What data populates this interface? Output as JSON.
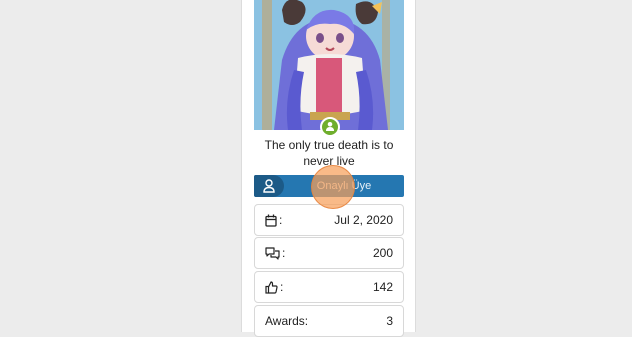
{
  "user": {
    "title": "The only true death is to never live",
    "banner": "Onaylı Üye"
  },
  "stats": {
    "joined": {
      "icon": "calendar-icon",
      "value": "Jul 2, 2020"
    },
    "messages": {
      "icon": "comments-icon",
      "value": "200"
    },
    "reactions": {
      "icon": "thumbs-up-icon",
      "value": "142"
    },
    "awards": {
      "label": "Awards:",
      "value": "3"
    }
  },
  "colors": {
    "banner": "#2577b1",
    "online": "#6fae2d"
  }
}
